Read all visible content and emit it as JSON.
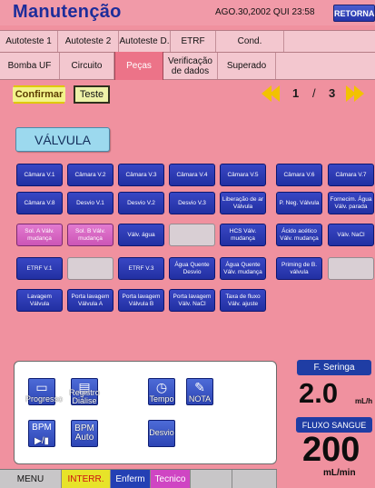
{
  "header": {
    "title": "Manutenção",
    "datetime": "AGO.30,2002 QUI 23:58",
    "back_label": "RETORNAR"
  },
  "tabs_row1": [
    {
      "label": "Autoteste 1"
    },
    {
      "label": "Autoteste 2"
    },
    {
      "label": "Autoteste D."
    },
    {
      "label": "ETRF"
    },
    {
      "label": "Cond."
    }
  ],
  "tabs_row2": [
    {
      "label": "Bomba UF"
    },
    {
      "label": "Circuito"
    },
    {
      "label": "Peças"
    },
    {
      "label": "Verificação de dados"
    },
    {
      "label": "Superado"
    }
  ],
  "actions": {
    "confirm_label": "Confirmar",
    "test_label": "Teste"
  },
  "pager": {
    "current": "1",
    "separator": "/",
    "total": "3"
  },
  "section_label": "VÁLVULA",
  "valve_buttons": [
    [
      "Câmara V.1",
      "Câmara V.2",
      "Câmara V.3",
      "Câmara V.4",
      "Câmara V.5",
      "Câmara V.6",
      "Câmara V.7"
    ],
    [
      "Câmara V.8",
      "Desvio V.1",
      "Desvio V.2",
      "Desvio V.3",
      "Liberação de ar Válvula",
      "P. Neg. Válvula",
      "Fornecim. Água Válv. parada"
    ],
    [
      "Sol. A Válv. mudança",
      "Sol. B Válv. mudança",
      "Válv. água",
      "",
      "HCS Válv. mudança",
      "Ácido acético Válv. mudança",
      "Válv. NaCl"
    ],
    [
      "ETRF V.1",
      "",
      "ETRF V.3",
      "Água Quente Desvio",
      "Água Quente Válv. mudança",
      "Priming de B. válvula",
      ""
    ],
    [
      "Lavagem Válvula",
      "Porta lavagem Válvula A",
      "Porta lavagem Válvula B",
      "Porta lavagem Válv. NaCl",
      "Taxa de fluxo Válv. ajuste"
    ]
  ],
  "bottom_buttons": {
    "progress": "Progresso",
    "registry": "Registro Diálise",
    "time": "Tempo",
    "note": "NOTA",
    "bpm_manual": "BPM",
    "bpm_auto": "BPM Auto",
    "bypass": "Desvio"
  },
  "seringa": {
    "label": "F. Seringa",
    "value": "2.0",
    "unit": "mL/h"
  },
  "fluxo": {
    "label": "FLUXO SANGUE",
    "value": "200",
    "unit": "mL/min"
  },
  "footer_tabs": [
    {
      "label": "MENU",
      "bg": "#c8c6c8",
      "fg": "#111111"
    },
    {
      "label": "INTERR.",
      "bg": "#e7e329",
      "fg": "#cc1111"
    },
    {
      "label": "Enferm",
      "bg": "#2440b4",
      "fg": "#ffffff"
    },
    {
      "label": "Tecnico",
      "bg": "#cf45c3",
      "fg": "#ffffff"
    },
    {
      "label": "",
      "bg": "#c8c6c8",
      "fg": "#111111"
    },
    {
      "label": "",
      "bg": "#c8c6c8",
      "fg": "#111111"
    }
  ]
}
